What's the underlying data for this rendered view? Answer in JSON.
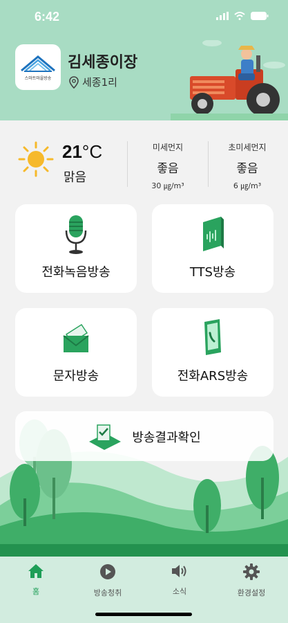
{
  "status_bar": {
    "time": "6:42"
  },
  "header": {
    "logo_caption": "스마트마을방송",
    "village_name": "김세종이장",
    "location": "세종1리"
  },
  "weather": {
    "temp_value": "21",
    "temp_unit": "°C",
    "condition": "맑음",
    "fine_dust": {
      "label": "미세먼지",
      "grade": "좋음",
      "value": "30 ㎍/m³"
    },
    "ultrafine_dust": {
      "label": "초미세먼지",
      "grade": "좋음",
      "value": "6 ㎍/m³"
    }
  },
  "menu": {
    "phone_recording": "전화녹음방송",
    "tts": "TTS방송",
    "text": "문자방송",
    "phone_ars": "전화ARS방송",
    "result_check": "방송결과확인"
  },
  "tabbar": {
    "items": [
      {
        "label": "홈",
        "icon": "home-icon",
        "active": true
      },
      {
        "label": "방송청취",
        "icon": "play-icon",
        "active": false
      },
      {
        "label": "소식",
        "icon": "speaker-icon",
        "active": false
      },
      {
        "label": "환경설정",
        "icon": "gear-icon",
        "active": false
      }
    ]
  },
  "colors": {
    "accent": "#1e9e57",
    "header_bg": "#a8dcc3",
    "tabbar_bg": "#d2ecdf"
  }
}
